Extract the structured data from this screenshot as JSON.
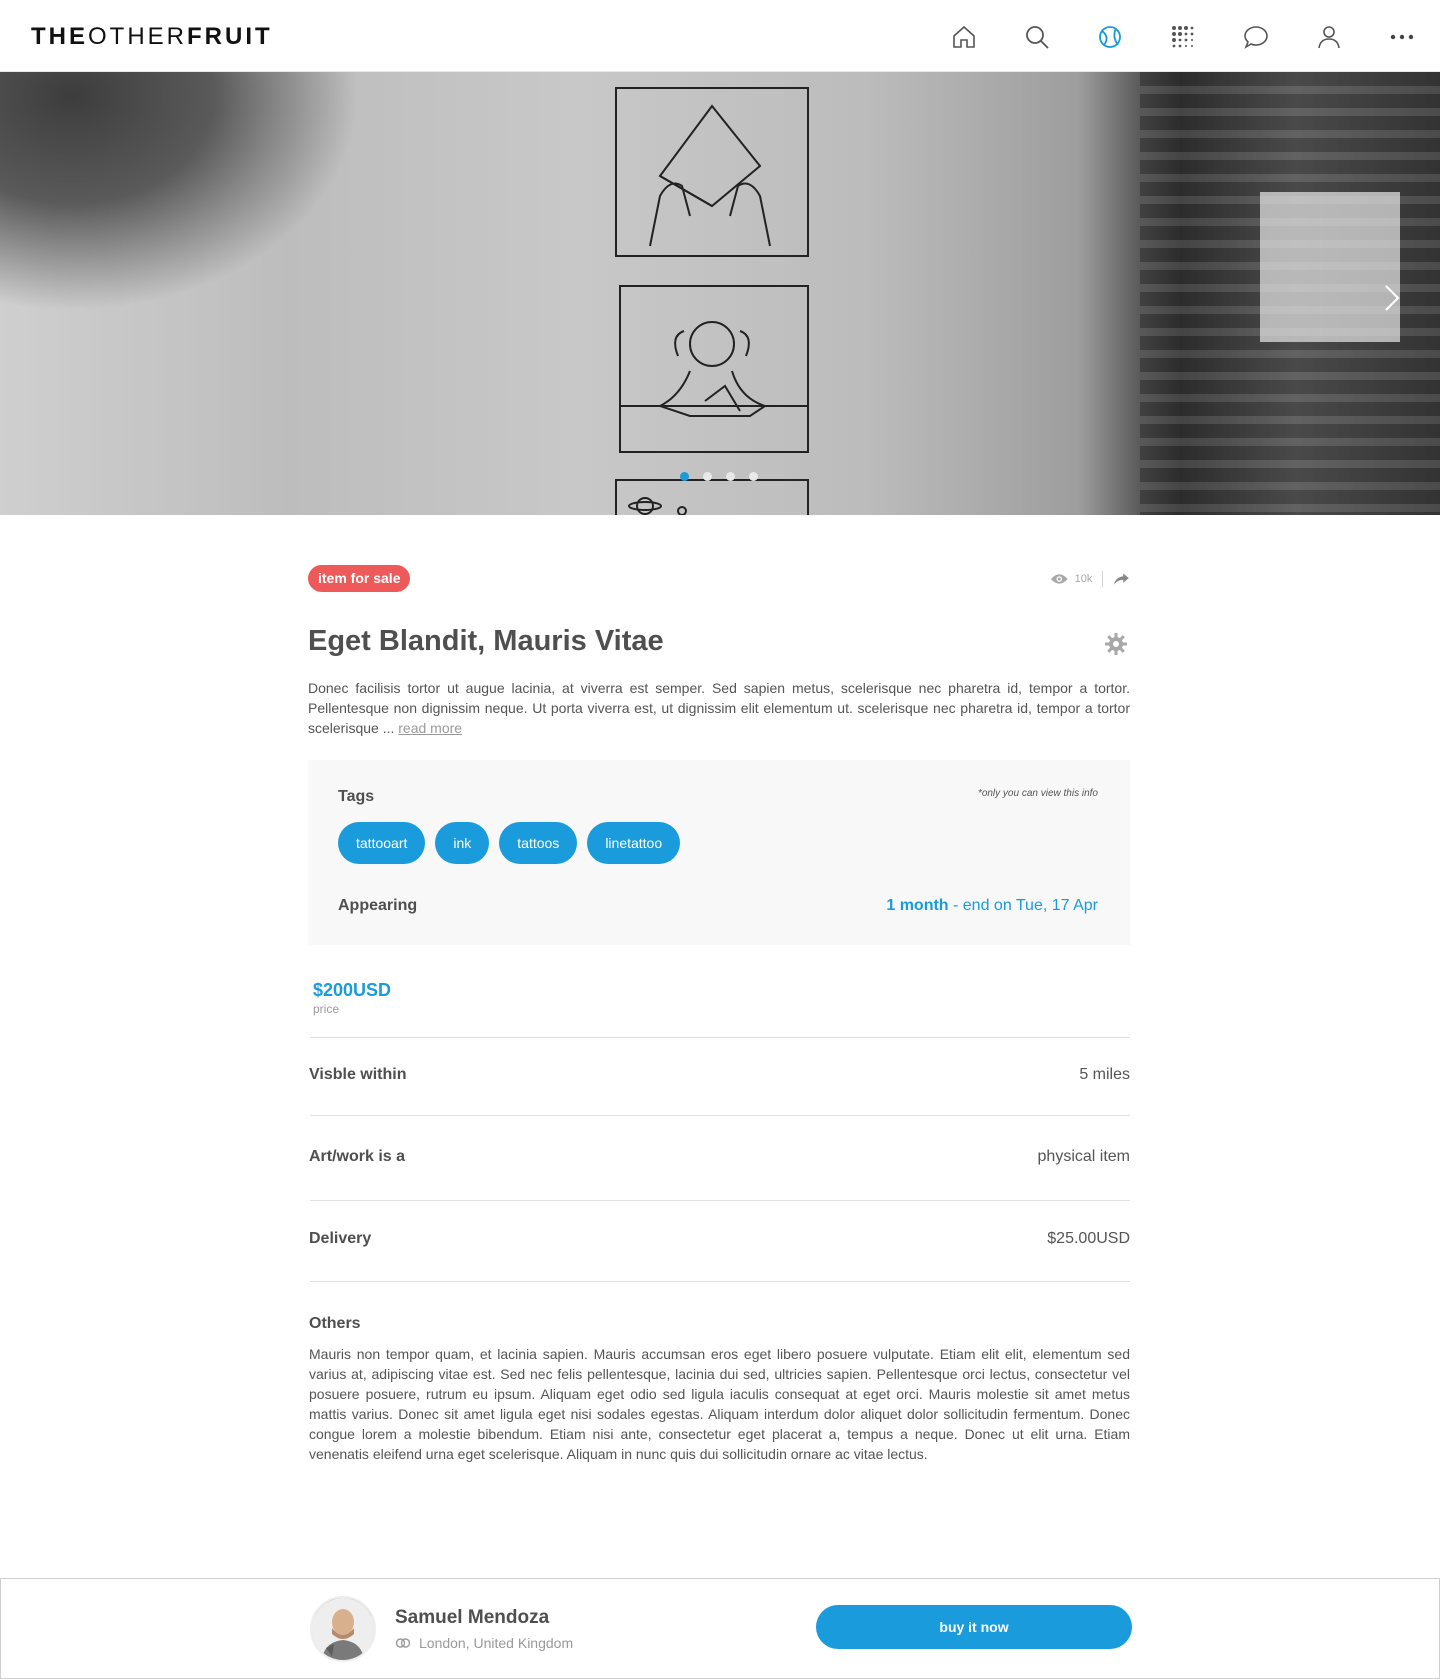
{
  "header": {
    "logo_bold_1": "THE",
    "logo_light": "OTHER",
    "logo_bold_2": "FRUIT",
    "nav": [
      {
        "icon": "home-icon"
      },
      {
        "icon": "search-icon"
      },
      {
        "icon": "globe-icon",
        "active": true
      },
      {
        "icon": "grid-dots-icon"
      },
      {
        "icon": "chat-bubble-icon"
      },
      {
        "icon": "user-icon"
      },
      {
        "icon": "more-icon"
      }
    ],
    "accent": "#1a9bdc"
  },
  "hero": {
    "next_icon": "chevron-right-icon",
    "slides_count": 4,
    "active_slide": 1
  },
  "listing": {
    "badge": "item for sale",
    "badge_color": "#ee5a5a",
    "views": "10k",
    "title": "Eget Blandit, Mauris Vitae",
    "description": "Donec facilisis tortor ut augue lacinia, at viverra est semper. Sed sapien metus, scelerisque nec pharetra id, tempor a tortor. Pellentesque non dignissim neque. Ut porta viverra est, ut dignissim elit elementum ut.  scelerisque nec pharetra id, tempor a tortor  scelerisque ... ",
    "read_more": "read more"
  },
  "panel": {
    "tags_label": "Tags",
    "private_note": "*only you can view this info",
    "tags": [
      "tattooart",
      "ink",
      "tattoos",
      "linetattoo"
    ],
    "appearing_label": "Appearing",
    "appearing_duration": "1 month",
    "appearing_end": " - end on Tue, 17 Apr"
  },
  "price": {
    "value": "$200USD",
    "label": "price"
  },
  "details": [
    {
      "label": "Visble within",
      "value": "5 miles"
    },
    {
      "label": "Art/work is a",
      "value": "physical item"
    },
    {
      "label": "Delivery",
      "value": "$25.00USD"
    }
  ],
  "others": {
    "label": "Others",
    "text": "Mauris non tempor quam, et lacinia sapien. Mauris accumsan eros eget libero posuere vulputate. Etiam elit elit, elementum sed varius at, adipiscing vitae est. Sed nec felis pellentesque, lacinia dui sed, ultricies sapien. Pellentesque orci lectus, consectetur vel posuere posuere, rutrum eu ipsum. Aliquam eget odio sed ligula iaculis consequat at eget orci. Mauris molestie sit amet metus mattis varius. Donec sit amet ligula eget nisi sodales egestas. Aliquam interdum dolor aliquet dolor sollicitudin fermentum. Donec congue lorem a molestie bibendum. Etiam nisi ante, consectetur eget placerat a, tempus a neque. Donec ut elit urna. Etiam venenatis eleifend urna eget scelerisque. Aliquam in nunc quis dui sollicitudin ornare ac vitae lectus."
  },
  "seller": {
    "name": "Samuel Mendoza",
    "location": "London, United Kingdom",
    "buy_label": "buy it now"
  }
}
